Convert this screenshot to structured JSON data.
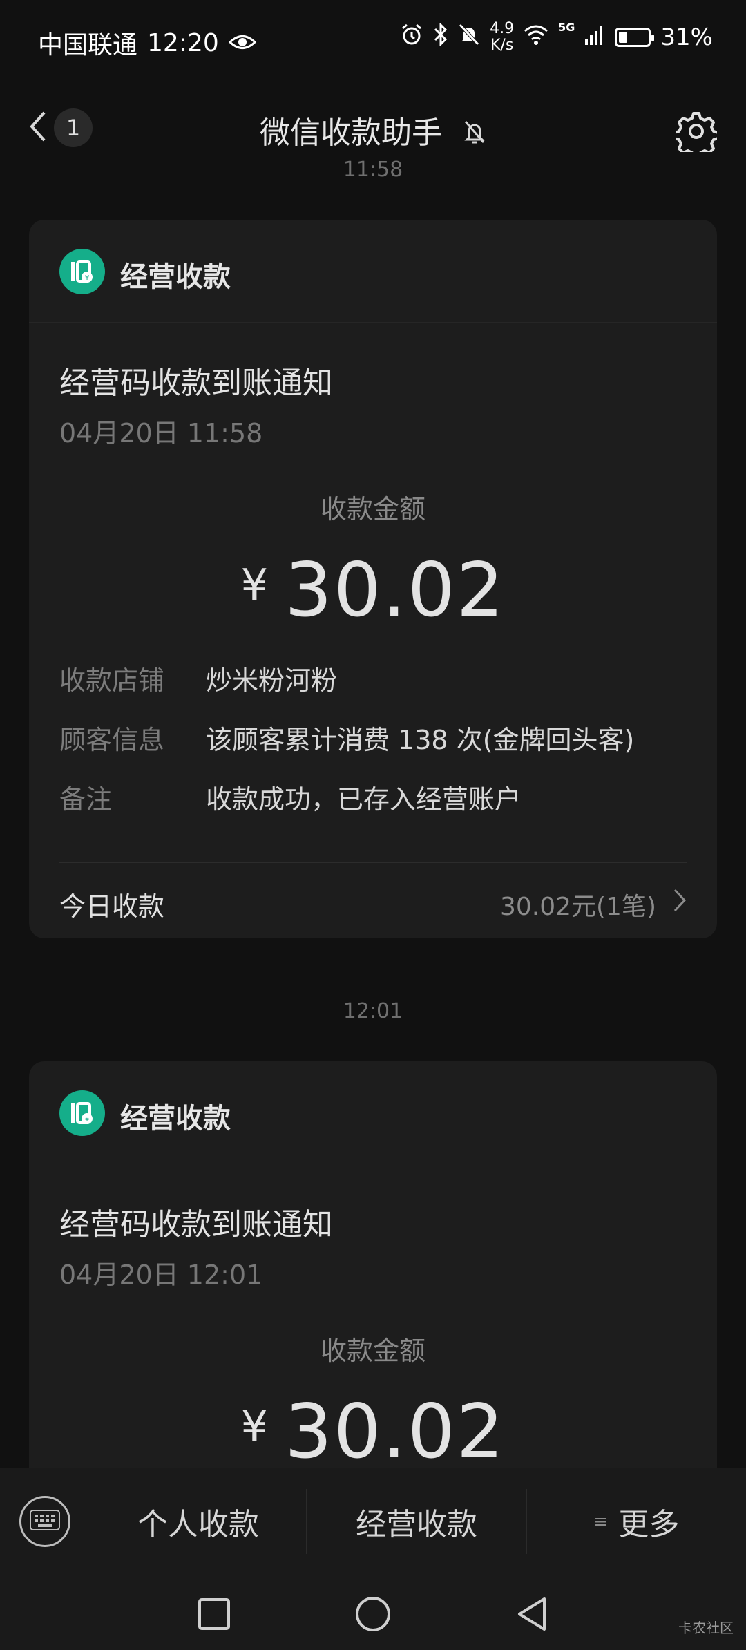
{
  "status_bar": {
    "carrier": "中国联通",
    "time": "12:20",
    "net_speed_value": "4.9",
    "net_speed_unit": "K/s",
    "network_type": "5G",
    "battery_text": "31%",
    "battery_level": 0.31
  },
  "header": {
    "unread_count": "1",
    "title": "微信收款助手"
  },
  "messages": [
    {
      "time": "11:58",
      "brand": "经营收款",
      "title": "经营码收款到账通知",
      "datetime": "04月20日 11:58",
      "amount_label": "收款金额",
      "currency": "¥",
      "amount": "30.02",
      "details": [
        {
          "key": "收款店铺",
          "value": "炒米粉河粉"
        },
        {
          "key": "顾客信息",
          "value": "该顾客累计消费 138 次(金牌回头客)"
        },
        {
          "key": "备注",
          "value": "收款成功，已存入经营账户"
        }
      ],
      "footer_label": "今日收款",
      "footer_value": "30.02元(1笔)"
    },
    {
      "time": "12:01",
      "brand": "经营收款",
      "title": "经营码收款到账通知",
      "datetime": "04月20日 12:01",
      "amount_label": "收款金额",
      "currency": "¥",
      "amount": "30.02"
    }
  ],
  "bottom_menu": {
    "items": [
      "个人收款",
      "经营收款",
      "更多"
    ]
  },
  "watermark": "卡农社区",
  "colors": {
    "background": "#111111",
    "card": "#1d1d1d",
    "brand_green": "#15ae8a"
  }
}
